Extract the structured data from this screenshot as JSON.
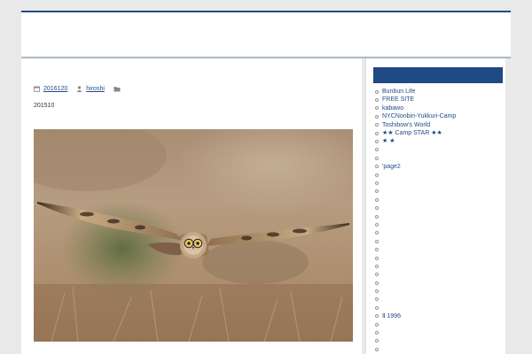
{
  "post": {
    "date": "2016120",
    "author": "hiroshi",
    "excerpt": "201510"
  },
  "photo": {
    "subject": "short-eared owl in flight over dry grassland"
  },
  "sidebar": {
    "links": [
      {
        "label": "Bunbun Life"
      },
      {
        "label": "FREE SITE"
      },
      {
        "label": "kabawo"
      },
      {
        "label": "NYCNonbiri-Yukkuri-Camp"
      },
      {
        "label": "Toshibow's World"
      },
      {
        "label": "★★ Camp STAR ★★"
      },
      {
        "label": "★                    ★"
      },
      {
        "label": ""
      },
      {
        "label": ""
      },
      {
        "label": "'page2"
      },
      {
        "label": ""
      },
      {
        "label": ""
      },
      {
        "label": ""
      },
      {
        "label": ""
      },
      {
        "label": ""
      },
      {
        "label": ""
      },
      {
        "label": ""
      },
      {
        "label": ""
      },
      {
        "label": ""
      },
      {
        "label": ""
      },
      {
        "label": ""
      },
      {
        "label": ""
      },
      {
        "label": ""
      },
      {
        "label": ""
      },
      {
        "label": ""
      },
      {
        "label": ""
      },
      {
        "label": ""
      },
      {
        "label": "Ⅱ                   1996"
      },
      {
        "label": ""
      },
      {
        "label": ""
      },
      {
        "label": ""
      },
      {
        "label": ""
      },
      {
        "label": ""
      },
      {
        "label": ""
      }
    ]
  },
  "colors": {
    "accent": "#1e4a85",
    "background": "#e9e9e9"
  }
}
